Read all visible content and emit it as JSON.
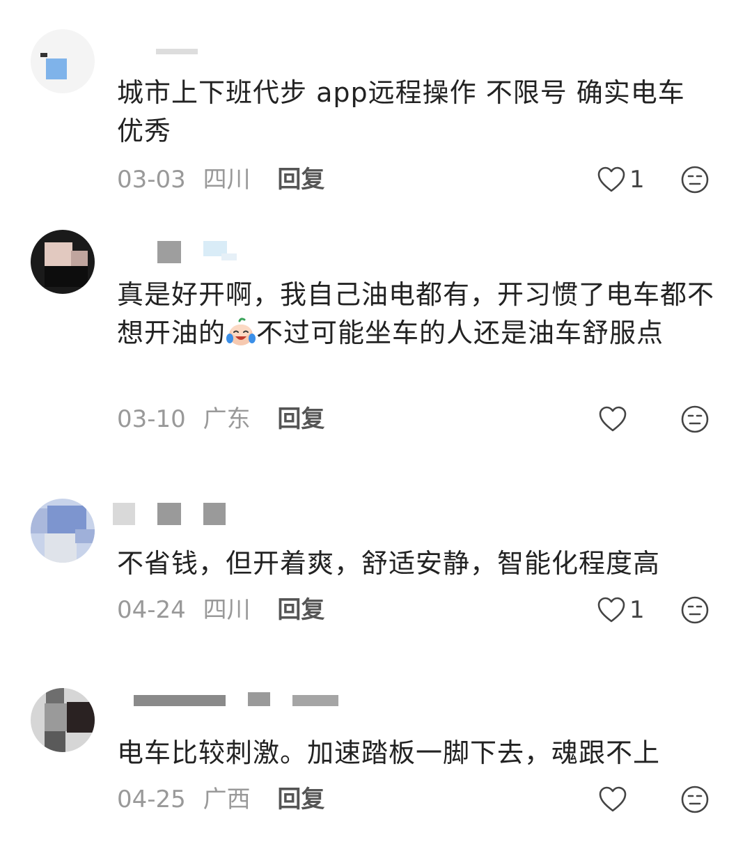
{
  "comments": [
    {
      "text": "城市上下班代步 app远程操作 不限号 确实电车优秀",
      "date": "03-03",
      "region": "四川",
      "reply_label": "回复",
      "likes": "1"
    },
    {
      "text_before_emoji": "真是好开啊，我自己油电都有，开习惯了电车都不想开油的",
      "emoji": "crying-laughing-emoji",
      "text_after_emoji": "不过可能坐车的人还是油车舒服点",
      "date": "03-10",
      "region": "广东",
      "reply_label": "回复",
      "likes": ""
    },
    {
      "text": "不省钱，但开着爽，舒适安静，智能化程度高",
      "date": "04-24",
      "region": "四川",
      "reply_label": "回复",
      "likes": "1"
    },
    {
      "text": "电车比较刺激。加速踏板一脚下去，魂跟不上",
      "date": "04-25",
      "region": "广西",
      "reply_label": "回复",
      "likes": ""
    }
  ],
  "icons": {
    "like": "heart-outline-icon",
    "dislike": "neutral-face-icon"
  },
  "colors": {
    "text": "#222222",
    "meta": "#999999",
    "reply": "#555555",
    "icon": "#444444"
  }
}
